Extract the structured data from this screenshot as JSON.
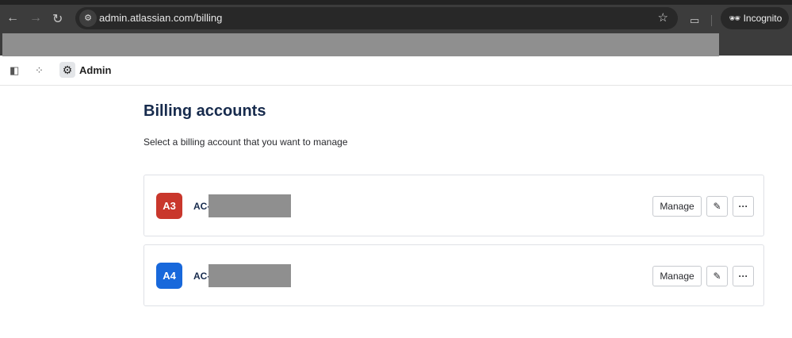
{
  "browser": {
    "url": "admin.atlassian.com/billing",
    "incognito_label": "Incognito"
  },
  "appbar": {
    "title": "Admin"
  },
  "page": {
    "title": "Billing accounts",
    "subtitle": "Select a billing account that you want to manage"
  },
  "accounts": [
    {
      "badge": "A3",
      "badge_color": "#c9372c",
      "id_prefix": "AC-",
      "manage_label": "Manage"
    },
    {
      "badge": "A4",
      "badge_color": "#1868db",
      "id_prefix": "AC-",
      "manage_label": "Manage"
    }
  ]
}
